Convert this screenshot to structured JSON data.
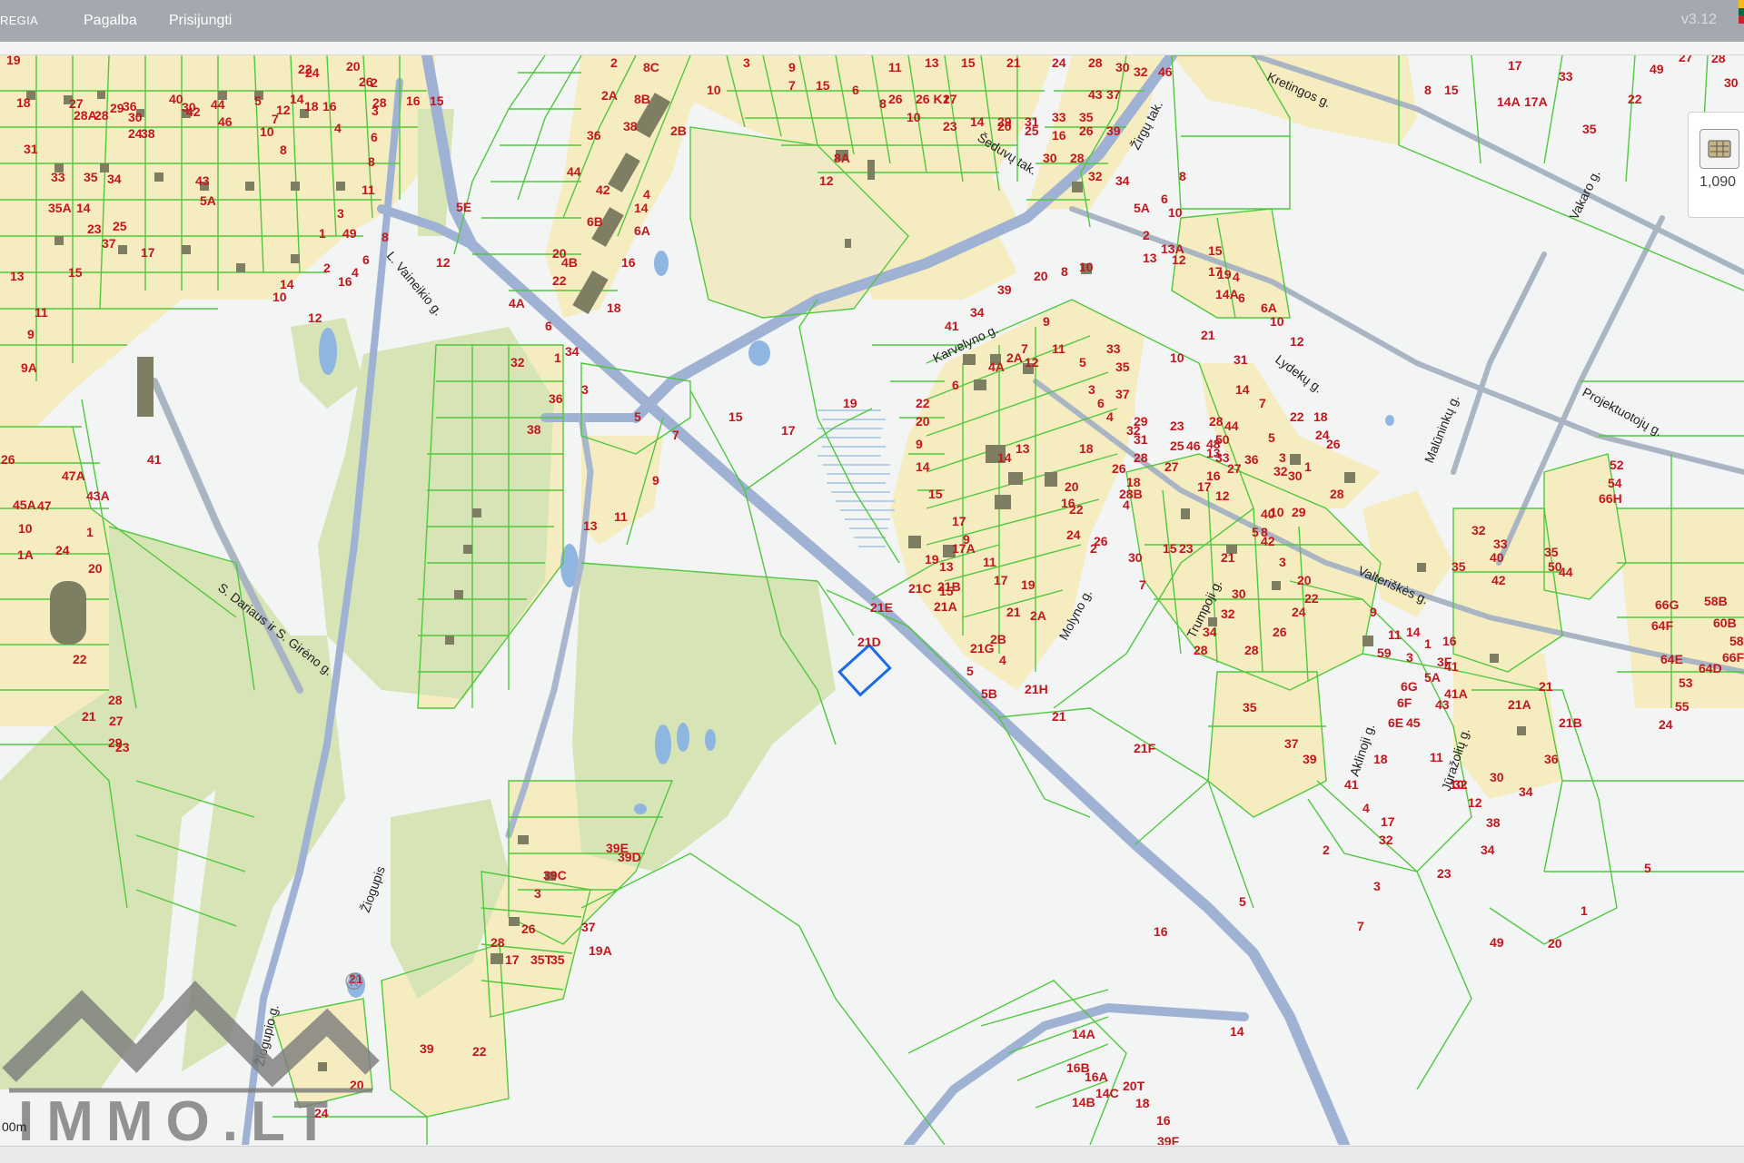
{
  "header": {
    "brand": "REGIA",
    "nav": [
      "Pagalba",
      "Prisijungti"
    ],
    "version": "v3.12"
  },
  "widget": {
    "value": "1,090",
    "icon": "basemap-layers-icon"
  },
  "scale_label": "00m",
  "colors": {
    "parcel_fill": "#f5ecbf",
    "parcel_line": "#50c83e",
    "park": "#d7e4b5",
    "road": "#9fb2d4",
    "building": "#7e7e62",
    "label": "#c4161c",
    "water": "#8fb6e0",
    "selection": "#1a6be8"
  },
  "streets": [
    "Kretingos g.",
    "Vakaro g.",
    "Šeduvų tak.",
    "Žirgų tak.",
    "Karvelyno g.",
    "Lydekų g.",
    "Malūninkų g.",
    "Projektuotojų g.",
    "L. Vaineikio g.",
    "S. Dariaus ir S. Girėno g.",
    "Molyno g.",
    "Trumpoji g.",
    "Valteriškės g.",
    "Aklinoji g.",
    "Jūražolių g.",
    "Žiogupis",
    "Žiogupio g."
  ],
  "parcels": [
    "2",
    "8C",
    "3",
    "9",
    "11",
    "13",
    "15",
    "21",
    "24",
    "28",
    "30",
    "32",
    "46",
    "2A",
    "8B",
    "10",
    "7",
    "15",
    "6",
    "8",
    "10",
    "23",
    "14",
    "20",
    "25",
    "16",
    "26",
    "30",
    "28",
    "32",
    "34",
    "36",
    "38",
    "2B",
    "8A",
    "12",
    "26",
    "26 K1",
    "27",
    "29",
    "31",
    "33",
    "35",
    "37",
    "39",
    "43",
    "44",
    "42",
    "4",
    "6B",
    "14",
    "6A",
    "16",
    "18",
    "20",
    "22",
    "4B",
    "4A",
    "6",
    "1",
    "3",
    "5",
    "7",
    "9",
    "11",
    "13",
    "15",
    "17",
    "19",
    "22",
    "20",
    "9",
    "14",
    "15",
    "17",
    "17A",
    "19",
    "21B",
    "21A",
    "21C",
    "21D",
    "21E",
    "21G",
    "21H",
    "21",
    "21F",
    "34",
    "41",
    "39",
    "20",
    "8",
    "10",
    "6",
    "4A",
    "2A",
    "12",
    "11",
    "9",
    "7",
    "5",
    "3",
    "4",
    "6",
    "10",
    "13",
    "14",
    "16",
    "18",
    "20",
    "22",
    "24",
    "26",
    "2",
    "4",
    "28B",
    "26",
    "28",
    "32",
    "33",
    "35",
    "37",
    "29",
    "31",
    "18",
    "16",
    "12",
    "10",
    "8",
    "23",
    "21",
    "30",
    "32",
    "34",
    "28",
    "36",
    "40",
    "42",
    "5",
    "3",
    "20",
    "22",
    "24",
    "26",
    "28",
    "30",
    "7",
    "15",
    "17",
    "27",
    "29",
    "31",
    "33",
    "35",
    "37",
    "39",
    "41",
    "4",
    "17",
    "32",
    "2",
    "3",
    "5",
    "7",
    "9",
    "11",
    "13",
    "15",
    "17",
    "19",
    "21",
    "2A",
    "2B",
    "4",
    "5",
    "5B",
    "5A",
    "6",
    "8",
    "10",
    "2",
    "13",
    "13A",
    "12",
    "15",
    "17",
    "19",
    "4",
    "6",
    "6A",
    "10",
    "12",
    "14",
    "14A",
    "21",
    "23",
    "25",
    "27",
    "13",
    "28",
    "44",
    "46",
    "48",
    "50",
    "18",
    "22",
    "24",
    "26",
    "28",
    "30",
    "32",
    "1",
    "3",
    "5",
    "7",
    "9",
    "11",
    "59",
    "3",
    "1",
    "3F",
    "5A",
    "6G",
    "6F",
    "6E",
    "18",
    "14",
    "16",
    "41",
    "41A",
    "43",
    "45",
    "11",
    "10",
    "12",
    "8",
    "15",
    "17",
    "17A",
    "14A",
    "33",
    "35",
    "22",
    "49",
    "27",
    "28",
    "30",
    "32",
    "33",
    "35",
    "40",
    "42",
    "35",
    "50",
    "44",
    "52",
    "54",
    "66H",
    "66G",
    "64F",
    "64E",
    "58B",
    "60B",
    "58A",
    "66F",
    "64D",
    "53",
    "55",
    "24",
    "21",
    "21A",
    "21B",
    "36",
    "34",
    "30",
    "32",
    "38",
    "34",
    "23",
    "5",
    "1",
    "49",
    "20",
    "16",
    "14",
    "14A",
    "16B",
    "16A",
    "14B",
    "14C",
    "18",
    "20T",
    "16",
    "39F",
    "39E",
    "39D",
    "39C",
    "3",
    "26",
    "28",
    "17",
    "35T",
    "35",
    "37",
    "19A",
    "21",
    "39",
    "20",
    "22",
    "24",
    "41",
    "43A",
    "47A",
    "45A",
    "47",
    "10",
    "1A",
    "1",
    "20",
    "22",
    "24",
    "26",
    "28",
    "27",
    "29",
    "21",
    "23",
    "19",
    "18",
    "31",
    "33",
    "35",
    "35A",
    "14",
    "15",
    "37",
    "17",
    "13",
    "11",
    "9",
    "9A",
    "23",
    "25",
    "27",
    "28A",
    "28",
    "29",
    "30",
    "24",
    "34",
    "36",
    "38",
    "40",
    "42",
    "44",
    "46",
    "43",
    "5A",
    "5",
    "7",
    "8",
    "10",
    "12",
    "14",
    "16",
    "4",
    "6",
    "2",
    "3",
    "8",
    "11",
    "16",
    "15",
    "5E",
    "12",
    "3",
    "49",
    "1",
    "2",
    "4",
    "6",
    "8",
    "10",
    "12",
    "14",
    "16",
    "18",
    "20",
    "22",
    "24",
    "26",
    "28",
    "30",
    "32",
    "34",
    "36",
    "38"
  ],
  "watermark": {
    "brand": "IMMO.LT",
    "mark": "®"
  }
}
